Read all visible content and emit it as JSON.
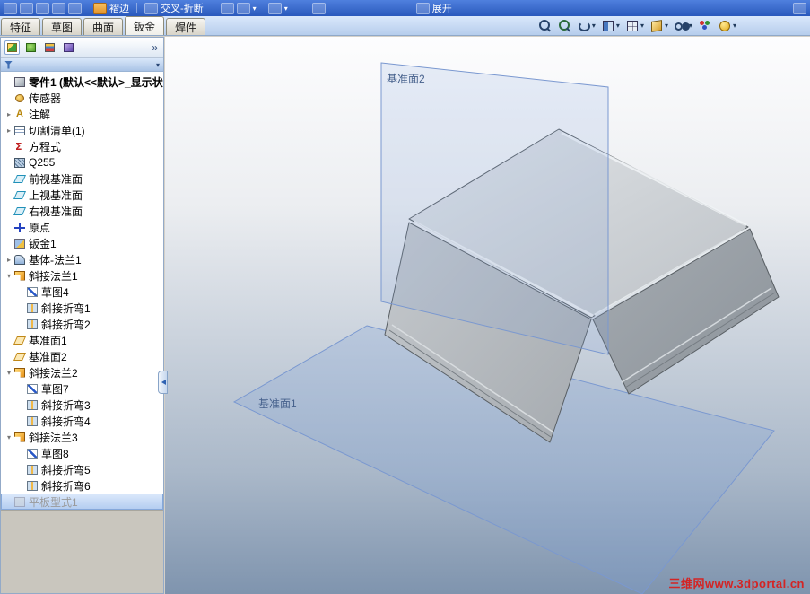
{
  "glyphs": {
    "dropdown": "▾",
    "collapsed": "▸",
    "expanded": "▾",
    "overflow": "»"
  },
  "top_toolbar": {
    "buttons": [
      {
        "name": "hem",
        "label": "褶边"
      },
      {
        "name": "cross-break",
        "label": "交叉-折断"
      },
      {
        "name": "unfold",
        "label": "展开"
      }
    ]
  },
  "tab_bar": {
    "tabs": [
      {
        "name": "features",
        "label": "特征",
        "active": false
      },
      {
        "name": "sketch",
        "label": "草图",
        "active": false
      },
      {
        "name": "surfaces",
        "label": "曲面",
        "active": false
      },
      {
        "name": "sheet-metal",
        "label": "钣金",
        "active": true
      },
      {
        "name": "weldments",
        "label": "焊件",
        "active": false
      }
    ]
  },
  "view_toolbar": {
    "icons": [
      {
        "name": "zoom-fit",
        "dropdown": false
      },
      {
        "name": "zoom-area",
        "dropdown": false
      },
      {
        "name": "previous-view",
        "dropdown": true
      },
      {
        "name": "section-view",
        "dropdown": true
      },
      {
        "name": "view-orientation",
        "dropdown": true
      },
      {
        "name": "display-style",
        "dropdown": true
      },
      {
        "name": "hide-show-items",
        "dropdown": true
      },
      {
        "name": "edit-appearance",
        "dropdown": false
      },
      {
        "name": "apply-scene",
        "dropdown": true
      }
    ]
  },
  "feature_tree": {
    "items": [
      {
        "label": "零件1  (默认<<默认>_显示状态",
        "icon": "part",
        "indent": 0,
        "bold": true
      },
      {
        "label": "传感器",
        "icon": "sensors",
        "indent": 0
      },
      {
        "label": "注解",
        "icon": "annotations",
        "indent": 0,
        "arrow": "collapsed"
      },
      {
        "label": "切割清单(1)",
        "icon": "cutlist",
        "indent": 0,
        "arrow": "collapsed"
      },
      {
        "label": "方程式",
        "icon": "equations",
        "indent": 0
      },
      {
        "label": "Q255",
        "icon": "material",
        "indent": 0
      },
      {
        "label": "前视基准面",
        "icon": "plane",
        "indent": 0
      },
      {
        "label": "上视基准面",
        "icon": "plane",
        "indent": 0
      },
      {
        "label": "右视基准面",
        "icon": "plane",
        "indent": 0
      },
      {
        "label": "原点",
        "icon": "origin",
        "indent": 0
      },
      {
        "label": "钣金1",
        "icon": "sheet-metal",
        "indent": 0
      },
      {
        "label": "基体-法兰1",
        "icon": "base-flange",
        "indent": 0,
        "arrow": "collapsed"
      },
      {
        "label": "斜接法兰1",
        "icon": "miter-flange",
        "indent": 0,
        "arrow": "expanded"
      },
      {
        "label": "草图4",
        "icon": "sketch",
        "indent": 1
      },
      {
        "label": "斜接折弯1",
        "icon": "miter-bend",
        "indent": 1
      },
      {
        "label": "斜接折弯2",
        "icon": "miter-bend",
        "indent": 1
      },
      {
        "label": "基准面1",
        "icon": "ref-plane",
        "indent": 0
      },
      {
        "label": "基准面2",
        "icon": "ref-plane",
        "indent": 0
      },
      {
        "label": "斜接法兰2",
        "icon": "miter-flange",
        "indent": 0,
        "arrow": "expanded"
      },
      {
        "label": "草图7",
        "icon": "sketch",
        "indent": 1
      },
      {
        "label": "斜接折弯3",
        "icon": "miter-bend",
        "indent": 1
      },
      {
        "label": "斜接折弯4",
        "icon": "miter-bend",
        "indent": 1
      },
      {
        "label": "斜接法兰3",
        "icon": "miter-flange",
        "indent": 0,
        "arrow": "expanded"
      },
      {
        "label": "草图8",
        "icon": "sketch",
        "indent": 1
      },
      {
        "label": "斜接折弯5",
        "icon": "miter-bend",
        "indent": 1
      },
      {
        "label": "斜接折弯6",
        "icon": "miter-bend",
        "indent": 1
      },
      {
        "label": "平板型式1",
        "icon": "flat-pattern",
        "indent": 0,
        "grayed": true,
        "selected": true
      }
    ]
  },
  "viewport": {
    "plane_labels": {
      "plane1": "基准面1",
      "plane2": "基准面2"
    },
    "watermark": "三维网www.3dportal.cn",
    "colors": {
      "plane_fill": "#7da0dc",
      "plane_edge": "#7a98d0",
      "part_gray": "#b8bdc2",
      "watermark_red": "#d42424"
    }
  }
}
